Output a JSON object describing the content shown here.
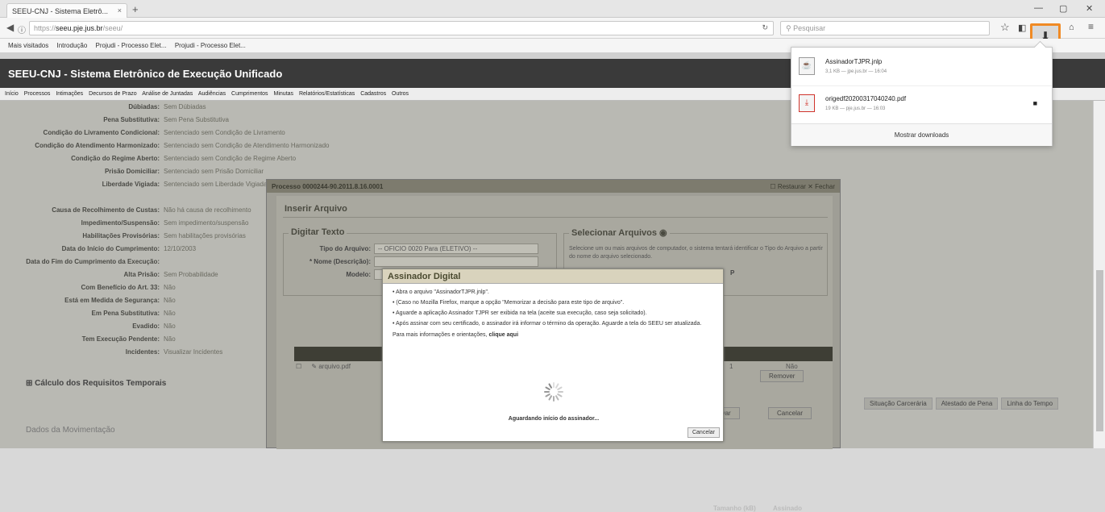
{
  "browser": {
    "tab_title": "SEEU-CNJ - Sistema Eletrô...",
    "tab_close": "×",
    "new_tab": "+",
    "win_min": "—",
    "win_max": "▢",
    "win_close": "✕",
    "url_prefix": "https://",
    "url_domain": "seeu.pje.jus.br",
    "url_suffix": "/seeu/",
    "search_placeholder": "Pesquisar",
    "bookmarks": [
      "Mais visitados",
      "Introdução",
      "Projudi - Processo Elet...",
      "Projudi - Processo Elet..."
    ]
  },
  "app": {
    "title": "SEEU-CNJ - Sistema Eletrônico de Execução Unificado",
    "menu": [
      "Início",
      "Processos",
      "Intimações",
      "Decursos de Prazo",
      "Análise de Juntadas",
      "Audiências",
      "Cumprimentos",
      "Minutas",
      "Relatórios/Estatísticas",
      "Cadastros",
      "Outros"
    ]
  },
  "background_fields": [
    {
      "label": "Dúbiadas:",
      "value": "Sem Dúbiadas"
    },
    {
      "label": "Pena Substitutiva:",
      "value": "Sem Pena Substitutiva"
    },
    {
      "label": "Condição do Livramento Condicional:",
      "value": "Sentenciado sem Condição de Livramento"
    },
    {
      "label": "Condição do Atendimento Harmonizado:",
      "value": "Sentenciado sem Condição de Atendimento Harmonizado"
    },
    {
      "label": "Condição do Regime Aberto:",
      "value": "Sentenciado sem Condição de Regime Aberto"
    },
    {
      "label": "Prisão Domiciliar:",
      "value": "Sentenciado sem Prisão Domiciliar"
    },
    {
      "label": "Liberdade Vigiada:",
      "value": "Sentenciado sem Liberdade Vigiada"
    },
    {
      "label": "Causa de Recolhimento de Custas:",
      "value": "Não há causa de recolhimento"
    },
    {
      "label": "Impedimento/Suspensão:",
      "value": "Sem impedimento/suspensão"
    },
    {
      "label": "Habilitações Provisórias:",
      "value": "Sem habilitações provisórias"
    },
    {
      "label": "Data do Início do Cumprimento:",
      "value": "12/10/2003"
    },
    {
      "label": "Data do Fim do Cumprimento da Execução:",
      "value": ""
    },
    {
      "label": "Alta Prisão:",
      "value": "Sem Probabilidade"
    },
    {
      "label": "Com Benefício do Art. 33:",
      "value": "Não"
    },
    {
      "label": "Está em Medida de Segurança:",
      "value": "Não"
    },
    {
      "label": "Em Pena Substitutiva:",
      "value": "Não"
    },
    {
      "label": "Evadido:",
      "value": "Não"
    },
    {
      "label": "Tem Execução Pendente:",
      "value": "Não"
    },
    {
      "label": "Incidentes:",
      "value": "Visualizar Incidentes"
    }
  ],
  "sections": {
    "calc": "Cálculo dos Requisitos Temporais",
    "mov": "Dados da Movimentação"
  },
  "bg_buttons": [
    "Situação Carcerária",
    "Atestado de Pena",
    "Linha do Tempo"
  ],
  "modal_process": {
    "title": "Processo 0000244-90.2011.8.16.0001",
    "controls": "☐ Restaurar  ✕ Fechar",
    "heading": "Inserir Arquivo",
    "type_heading": "Digitar Texto",
    "select_heading": "Selecionar Arquivos",
    "select_help": "Selecione um ou mais arquivos de computador, o sistema tentará identificar o Tipo do Arquivo a partir do nome do arquivo selecionado.",
    "field_tipo": "Tipo do Arquivo:",
    "field_tipo_value": "-- OFICIO 0020 Para (ELETIVO) --",
    "field_nome": "* Nome (Descrição):",
    "field_modelo": "Modelo:",
    "table_arquivo": "arquivo.pdf",
    "table_col1": "Tamanho (kB)",
    "table_col2": "Assinado",
    "table_val1": "1",
    "table_val2": "Não",
    "btn_remove": "Remover",
    "btn_cancel": "Cancelar",
    "btn_save": "Salvar"
  },
  "assinador": {
    "title": "Assinador Digital",
    "steps": [
      "Abra o arquivo \"AssinadorTJPR.jnlp\".",
      "(Caso no Mozilla Firefox, marque a opção \"Memorizar a decisão para este tipo de arquivo\".",
      "Aguarde a aplicação Assinador TJPR ser exibida na tela (aceite sua execução, caso seja solicitado).",
      "Após assinar com seu certificado, o assinador irá informar o término da operação. Aguarde a tela do SEEU ser atualizada."
    ],
    "more_prefix": "Para mais informações e orientações,",
    "more_link": "clique aqui",
    "waiting": "Aguardando início do assinador...",
    "cancel": "Cancelar"
  },
  "downloads": {
    "items": [
      {
        "name": "AssinadorTJPR.jnlp",
        "status": "3,1 KB — jpe.jus.br — 16:04",
        "icon": "java-file-icon",
        "glyph": "☕",
        "action": ""
      },
      {
        "name": "origedf20200317040240.pdf",
        "status": "19 KB — pje.jus.br — 16:03",
        "icon": "pdf-file-icon",
        "glyph": "⤓",
        "action": "■"
      }
    ],
    "show_all": "Mostrar downloads"
  },
  "colors": {
    "accent": "#f08a24",
    "header_bg": "#3a3a3a"
  }
}
